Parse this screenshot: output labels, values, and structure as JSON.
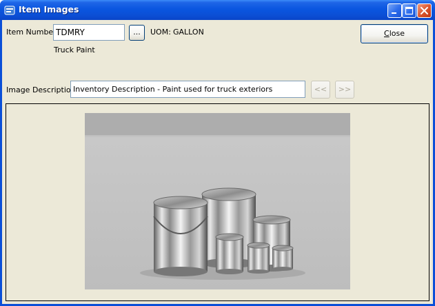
{
  "window": {
    "title": "Item Images",
    "controls": [
      "minimize-icon",
      "maximize-icon",
      "close-icon"
    ]
  },
  "form": {
    "item_number_label": "Item Number:",
    "item_number_value": "TDMRY",
    "lookup_label": "...",
    "uom_label": "UOM:",
    "uom_value": "GALLON",
    "item_description": "Truck Paint",
    "close_label_underlined": "C",
    "close_label_rest": "lose",
    "image_description_label": "Image Description:",
    "image_description_value": "Inventory Description - Paint used for truck exteriors",
    "prev_label": "<<",
    "next_label": ">>"
  },
  "colors": {
    "titlebar": "#0a56e0",
    "client_bg": "#ece9d8",
    "input_border": "#7f9db9"
  }
}
